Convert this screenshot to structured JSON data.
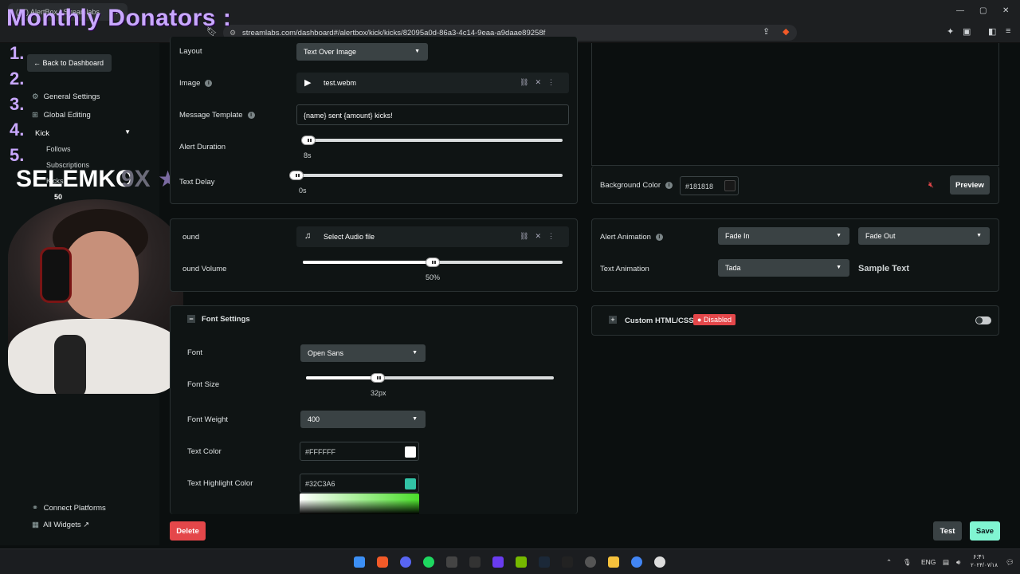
{
  "browser": {
    "tab_title": "(17) AlertBox | Streamlabs",
    "tab_close": "✕",
    "url": "streamlabs.com/dashboard#/alertbox/kick/kicks/82095a0d-86a3-4c14-9eaa-a9daae89258f",
    "window_controls": [
      "—",
      "▢",
      "✕"
    ]
  },
  "overlay": {
    "title": "Monthly Donators :",
    "ranks": [
      "1.",
      "2.",
      "3.",
      "4.",
      "5."
    ],
    "streamer_name": "SELEMKO",
    "streamer_suffix": "9X",
    "count": "50"
  },
  "sidebar": {
    "back_label": "Back to Dashboard",
    "items": [
      {
        "label": "General Settings",
        "icon": "gear-icon"
      },
      {
        "label": "Global Editing",
        "icon": "grid-icon"
      }
    ],
    "group": "Kick",
    "sub_items": [
      "Follows",
      "Subscriptions",
      "Kicks"
    ],
    "bottom": [
      {
        "label": "Connect Platforms",
        "icon": "link-icon"
      },
      {
        "label": "All Widgets",
        "icon": "widgets-icon"
      }
    ]
  },
  "settings": {
    "layout_label": "Layout",
    "layout_value": "Text Over Image",
    "image_label": "Image",
    "image_file": "test.webm",
    "template_label": "Message Template",
    "template_value": "{name} sent {amount} kicks!",
    "duration_label": "Alert Duration",
    "duration_value": "8s",
    "duration_fraction": 0.02,
    "delay_label": "Text Delay",
    "delay_value": "0s",
    "delay_fraction": 0.0
  },
  "sound": {
    "sound_label": "ound",
    "sound_value": "Select Audio file",
    "volume_label": "ound Volume",
    "volume_value": "50%",
    "volume_fraction": 0.5
  },
  "font": {
    "section_title": "Font Settings",
    "font_label": "Font",
    "font_value": "Open Sans",
    "size_label": "Font Size",
    "size_value": "32px",
    "size_fraction": 0.29,
    "weight_label": "Font Weight",
    "weight_value": "400",
    "color_label": "Text Color",
    "color_value": "#FFFFFF",
    "highlight_label": "Text Highlight Color",
    "highlight_value": "#32C3A6"
  },
  "right": {
    "bg_label": "Background Color",
    "bg_value": "#181818",
    "preview_label": "Preview",
    "anim_label": "Alert Animation",
    "anim_in": "Fade In",
    "anim_out": "Fade Out",
    "text_anim_label": "Text Animation",
    "text_anim_value": "Tada",
    "sample_text": "Sample Text",
    "custom_label": "Custom HTML/CSS",
    "custom_status": "Disabled"
  },
  "footer": {
    "delete_label": "Delete",
    "test_label": "Test",
    "save_label": "Save"
  },
  "taskbar": {
    "lang": "ENG",
    "time": "۶:۴۱",
    "date": "۲۰۲۴/۰۷/۱۸"
  },
  "colors": {
    "accent_green": "#80f5d2",
    "danger": "#e4474a",
    "text_color": "#FFFFFF",
    "highlight": "#32C3A6",
    "bg": "#181818"
  }
}
